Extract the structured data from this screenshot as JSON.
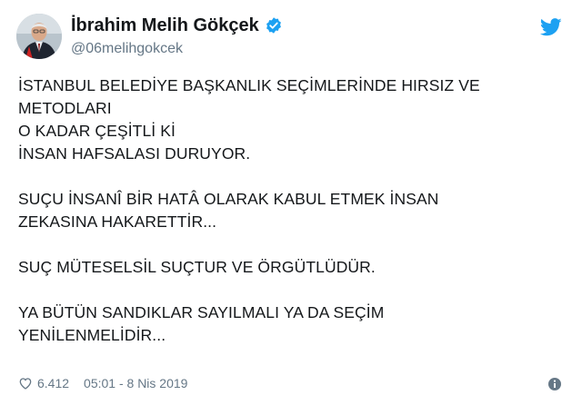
{
  "tweet": {
    "author": {
      "display_name": "İbrahim Melih Gökçek",
      "handle": "@06melihgokcek",
      "verified": true
    },
    "paragraphs": [
      [
        "İSTANBUL BELEDİYE BAŞKANLIK SEÇİMLERİNDE HIRSIZ VE",
        "METODLARI",
        "O KADAR ÇEŞİTLİ Kİ",
        "İNSAN HAFSALASI DURUYOR."
      ],
      [
        "SUÇU İNSANÎ BİR HATÂ OLARAK KABUL ETMEK İNSAN",
        "ZEKASINA HAKARETTİR..."
      ],
      [
        "SUÇ MÜTESELSİL SUÇTUR VE ÖRGÜTLÜDÜR."
      ],
      [
        "YA BÜTÜN SANDIKLAR SAYILMALI YA DA SEÇİM",
        "YENİLENMELİDİR..."
      ]
    ],
    "likes": "6.412",
    "timestamp": "05:01 - 8 Nis 2019"
  },
  "icons": {
    "verified": "verified-badge-icon",
    "platform": "twitter-bird-icon",
    "like": "heart-icon",
    "info": "info-icon"
  },
  "colors": {
    "brand_blue": "#1da1f2",
    "text_primary": "#14171a",
    "text_secondary": "#657786"
  }
}
